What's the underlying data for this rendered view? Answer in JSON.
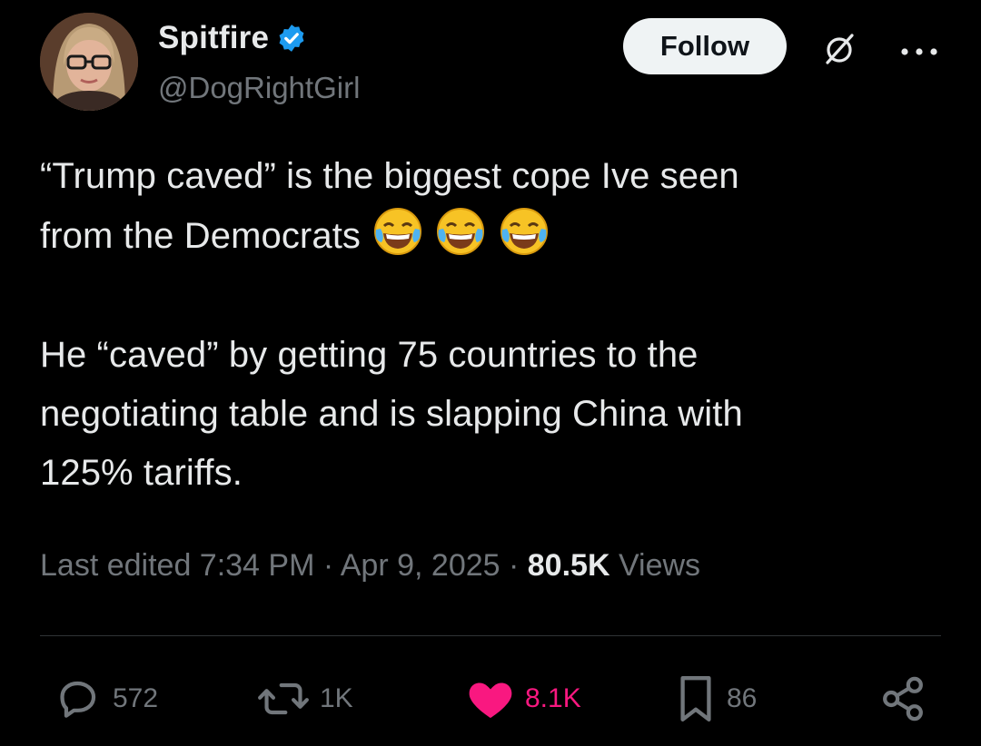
{
  "author": {
    "display_name": "Spitfire",
    "handle": "@DogRightGirl",
    "verified": true,
    "verified_color": "#1d9bf0"
  },
  "header": {
    "follow_label": "Follow",
    "grok_icon": "slashed-circle-icon",
    "more_icon": "more-dots-icon"
  },
  "tweet": {
    "line1": "“Trump caved” is the biggest cope Ive seen",
    "line2": "from the Democrats",
    "emoji": "😂😂😂",
    "paragraph2_line1": "He “caved” by getting 75 countries to the",
    "paragraph2_line2": "negotiating table and is slapping China with",
    "paragraph2_line3": "125% tariffs."
  },
  "meta": {
    "edited_prefix": "Last edited 7:34 PM · Apr 9, 2025 · ",
    "views_count": "80.5K",
    "views_label": " Views"
  },
  "actions": {
    "replies": "572",
    "reposts": "1K",
    "likes": "8.1K",
    "bookmarks": "86",
    "like_color": "#f91880"
  }
}
